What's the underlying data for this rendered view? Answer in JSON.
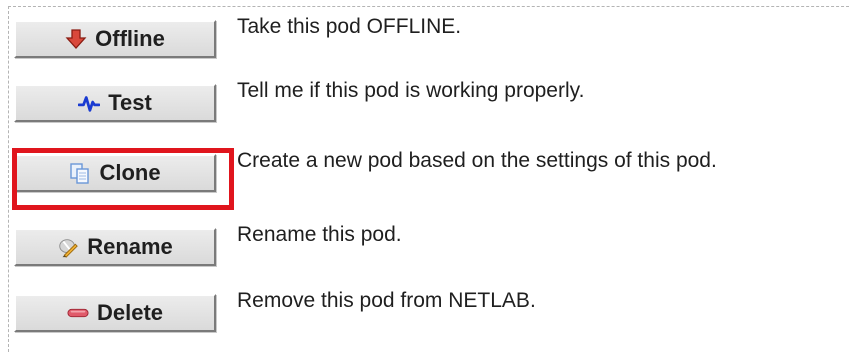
{
  "actions": [
    {
      "id": "offline",
      "label": "Offline",
      "icon": "arrow-down-icon",
      "description": "Take this pod OFFLINE."
    },
    {
      "id": "test",
      "label": "Test",
      "icon": "pulse-icon",
      "description": "Tell me if this pod is working properly."
    },
    {
      "id": "clone",
      "label": "Clone",
      "icon": "copy-icon",
      "description": "Create a new pod based on the settings of this pod."
    },
    {
      "id": "rename",
      "label": "Rename",
      "icon": "edit-icon",
      "description": "Rename this pod."
    },
    {
      "id": "delete",
      "label": "Delete",
      "icon": "minus-icon",
      "description": "Remove this pod from NETLAB."
    }
  ],
  "highlighted_action": "clone",
  "colors": {
    "highlight_border": "#e0151d",
    "offline_icon": "#d9483b",
    "test_icon": "#1a3bd1",
    "clone_icon": "#6a97d8",
    "delete_icon": "#e05a6a"
  }
}
